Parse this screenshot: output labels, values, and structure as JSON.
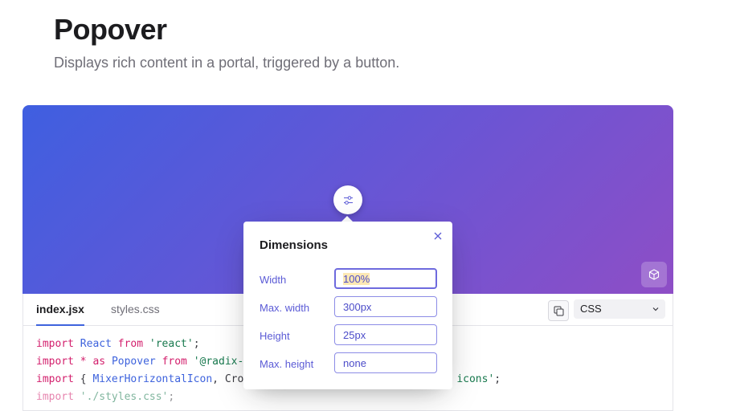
{
  "page": {
    "title": "Popover",
    "subtitle": "Displays rich content in a portal, triggered by a button."
  },
  "preview": {
    "gradient_start": "#3f5fe0",
    "gradient_end": "#8e4ec6",
    "trigger_icon": "mixer-horizontal-icon",
    "sandbox_icon": "cube-icon"
  },
  "code_panel": {
    "tabs": [
      {
        "label": "index.jsx",
        "active": true
      },
      {
        "label": "styles.css",
        "active": false
      }
    ],
    "copy_icon": "copy-icon",
    "language": "CSS",
    "lines": [
      {
        "k1": "import",
        "a": " ",
        "b": "React",
        "c": " ",
        "k2": "from",
        "d": " ",
        "s": "'react'",
        "e": ";"
      },
      {
        "k1": "import",
        "a": " ",
        "k3": "* as",
        "b2": " ",
        "b": "Popover",
        "c": " ",
        "k2": "from",
        "d": " ",
        "s": "'@radix-",
        "e": ""
      },
      {
        "k1": "import",
        "a": " { ",
        "b": "MixerHorizontalIcon",
        "c": ", Cro",
        "tail": "icons'",
        "end": ";"
      },
      {
        "k1": "import",
        "s": "'./styles.css'",
        "e": ";"
      }
    ]
  },
  "popover": {
    "title": "Dimensions",
    "close_icon": "cross-icon",
    "fields": [
      {
        "label": "Width",
        "value": "100%"
      },
      {
        "label": "Max. width",
        "value": "300px"
      },
      {
        "label": "Height",
        "value": "25px"
      },
      {
        "label": "Max. height",
        "value": "none"
      }
    ]
  }
}
